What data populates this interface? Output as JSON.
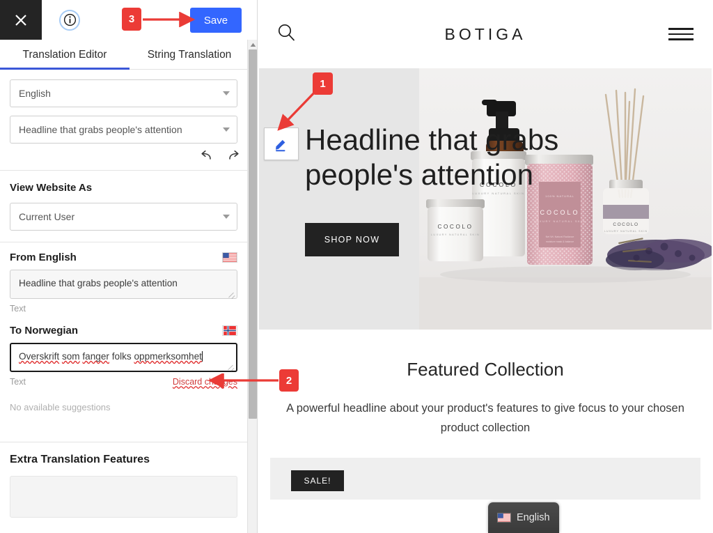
{
  "sidebar": {
    "topbar": {
      "close_icon": "close-x-icon",
      "info_icon": "info-circle-icon",
      "save_label": "Save"
    },
    "tabs": [
      {
        "label": "Translation Editor",
        "active": true
      },
      {
        "label": "String Translation",
        "active": false
      }
    ],
    "language_select": {
      "value": "English",
      "caret": "chevron-down-icon"
    },
    "string_select": {
      "value": "Headline that grabs people's attention",
      "caret": "chevron-down-icon"
    },
    "history": {
      "undo_icon": "undo-arrow-icon",
      "redo_icon": "redo-arrow-icon"
    },
    "view_website_as": {
      "label": "View Website As",
      "select_value": "Current User",
      "caret": "chevron-down-icon"
    },
    "from": {
      "label": "From English",
      "flag": "us-flag-icon",
      "value": "Headline that grabs people's attention",
      "hint": "Text"
    },
    "to": {
      "label": "To Norwegian",
      "flag": "norway-flag-icon",
      "value": "Overskrift som fanger folks oppmerksomhet",
      "value_tokens": [
        {
          "t": "Overskrift",
          "misspelled": true
        },
        {
          "t": " ",
          "misspelled": false
        },
        {
          "t": "som",
          "misspelled": true
        },
        {
          "t": " ",
          "misspelled": false
        },
        {
          "t": "fanger",
          "misspelled": true
        },
        {
          "t": " folks ",
          "misspelled": false
        },
        {
          "t": "oppmerksomhet",
          "misspelled": true
        }
      ],
      "hint": "Text",
      "discard_label": "Discard changes"
    },
    "suggestions_text": "No available suggestions",
    "extra_features_label": "Extra Translation Features",
    "scrollbar": {
      "up_icon": "scroll-up-arrow-icon"
    }
  },
  "preview": {
    "header": {
      "search_icon": "search-icon",
      "logo": "BOTIGA",
      "menu_icon": "hamburger-menu-icon"
    },
    "hero": {
      "edit_icon": "pencil-edit-icon",
      "headline": "Headline that grabs people's attention",
      "cta_label": "SHOP NOW",
      "image_alt": "cocolo-cosmetics-products-photo",
      "product_brand": "COCOLO"
    },
    "featured": {
      "title": "Featured Collection",
      "subtitle": "A powerful headline about your product's features to give focus to your chosen product collection",
      "sale_badge": "SALE!"
    },
    "language_switcher": {
      "label": "English",
      "flag": "us-flag-icon"
    }
  },
  "annotations": [
    {
      "id": "1",
      "label": "1"
    },
    {
      "id": "2",
      "label": "2"
    },
    {
      "id": "3",
      "label": "3"
    }
  ],
  "colors": {
    "accent_blue": "#3366ff",
    "annotation_red": "#ec3b36",
    "tab_underline": "#3b57d8",
    "hero_bg": "#e6e6e6",
    "dark": "#222222"
  }
}
